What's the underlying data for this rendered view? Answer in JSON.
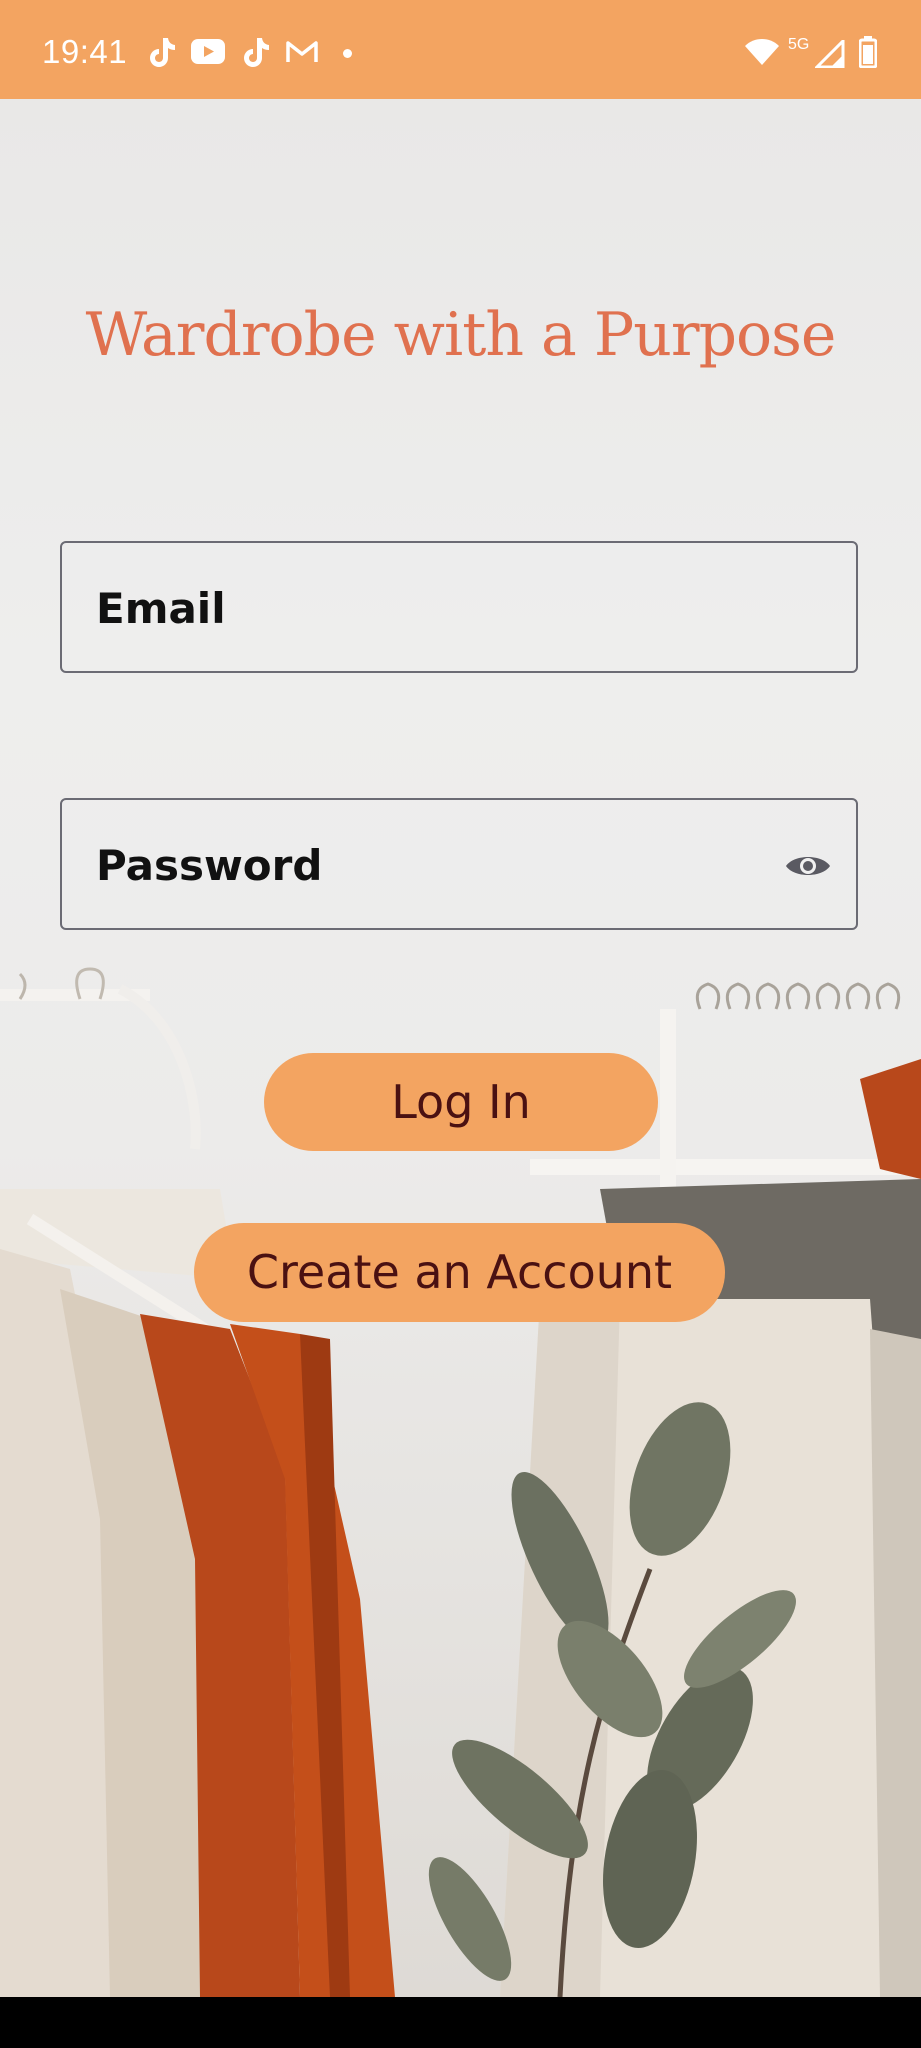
{
  "status_bar": {
    "time": "19:41",
    "notification_icons": [
      "tiktok-icon",
      "youtube-icon",
      "tiktok-icon",
      "gmail-icon",
      "more-notifications-dot"
    ],
    "system_icons": [
      "wifi-icon",
      "5g-signal-icon",
      "battery-icon"
    ],
    "network_label": "5G",
    "color": "#F3A461"
  },
  "app": {
    "title": "Wardrobe with a Purpose",
    "title_color": "#E0714F"
  },
  "form": {
    "email_placeholder": "Email",
    "password_placeholder": "Password",
    "password_toggle_icon": "eye-icon"
  },
  "buttons": {
    "login_label": "Log In",
    "create_account_label": "Create an Account",
    "button_color": "#F3A461",
    "button_text_color": "#4a1112"
  },
  "background": {
    "description_icon": "clothing-rack-photo"
  }
}
